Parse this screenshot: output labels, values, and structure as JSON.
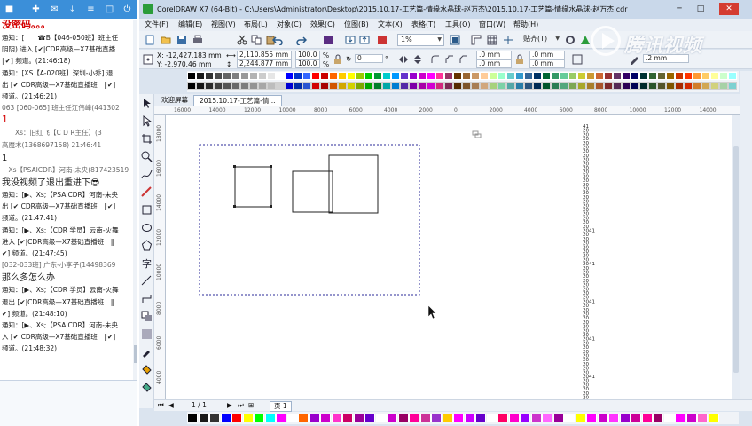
{
  "chat": {
    "title_icons": [
      "qq-icon",
      "game-icon",
      "mail-icon",
      "download-icon",
      "menu-icon",
      "restore-icon",
      "power-icon"
    ],
    "scroll_fraction": 0.95,
    "messages": [
      {
        "text": "没密码。。。",
        "style": "pass"
      },
      {
        "text": "通知：[　　☎B【046-050班】班主任",
        "style": ""
      },
      {
        "text": "阴阴) 进入 [✔|CDR高级—X7基础直播",
        "style": ""
      },
      {
        "text": "‖✔] 频道。(21:46:18)",
        "style": ""
      },
      {
        "text": "通知：[XS【A-020班】深圳-小乔] 退",
        "style": ""
      },
      {
        "text": "出 [✔|CDR高级—X7基础直播班　‖✔]",
        "style": ""
      },
      {
        "text": "频道。(21:46:21)",
        "style": ""
      },
      {
        "text": "063 [060-065] 班主任江伟峰(441302",
        "style": "gray"
      },
      {
        "text": "1",
        "style": "red"
      },
      {
        "text": "　　Xs：旧红飞【C D R主任】(3",
        "style": "gray"
      },
      {
        "text": "高魔术(1368697158) 21:46:41",
        "style": "gray"
      },
      {
        "text": "1",
        "style": "big"
      },
      {
        "text": "　Xs【PSAICDR】河南-未央(817423519",
        "style": "gray"
      },
      {
        "text": "我没视频了退出重进下😎",
        "style": "big"
      },
      {
        "text": "通知：[▶、Xs;【PSAICDR】河南-未央",
        "style": ""
      },
      {
        "text": "出 [✔|CDR高级—X7基础直播班　‖✔]",
        "style": ""
      },
      {
        "text": "频道。(21:47:41)",
        "style": ""
      },
      {
        "text": "通知：[▶、Xs;【CDR 学员】云南-火舞",
        "style": ""
      },
      {
        "text": "进入 [✔|CDR高级—X7基础直播班　‖",
        "style": ""
      },
      {
        "text": "✔] 频道。(21:47:45)",
        "style": ""
      },
      {
        "text": "[032-033班] 广东-小李子(14498369",
        "style": "gray"
      },
      {
        "text": "那么多怎么办",
        "style": "big"
      },
      {
        "text": "通知：[▶、Xs;【CDR 学员】云南-火舞",
        "style": ""
      },
      {
        "text": "退出 [✔|CDR高级—X7基础直播班　‖",
        "style": ""
      },
      {
        "text": "✔] 频道。(21:48:10)",
        "style": ""
      },
      {
        "text": "通知：[▶、Xs;【PSAICDR】河南-未央",
        "style": ""
      },
      {
        "text": "入 [✔|CDR高级—X7基础直播班　‖✔]",
        "style": ""
      },
      {
        "text": "频道。(21:48:32)",
        "style": ""
      }
    ]
  },
  "app": {
    "title": "CorelDRAW X7 (64-Bit) - C:\\Users\\Administrator\\Desktop\\2015.10.17-工艺篇-情缘水晶球-赵万杰\\2015.10.17-工艺篇-情缘水晶球-赵万杰.cdr",
    "window_buttons": {
      "minimize": "─",
      "maximize": "□",
      "close": "✕"
    },
    "menu": [
      "文件(F)",
      "编辑(E)",
      "视图(V)",
      "布局(L)",
      "对象(C)",
      "效果(C)",
      "位图(B)",
      "文本(X)",
      "表格(T)",
      "工具(O)",
      "窗口(W)",
      "帮助(H)"
    ],
    "toolbar": {
      "zoom": "1%",
      "snap": "贴齐(T)"
    },
    "props": {
      "x": "X: -12,427.183 mm",
      "y": "Y: -2,970.46 mm",
      "w": "2,110.855 mm",
      "h": "2,244.877 mm",
      "scale_w": "100.0",
      "scale_h": "100.0",
      "pct": "%",
      "angle": "0",
      "deg": "°",
      "corner_a": ".0 mm",
      "corner_b": ".0 mm",
      "corner_c": ".0 mm",
      "corner_d": ".0 mm",
      "outline": ".2 mm"
    },
    "tabs": {
      "welcome": "欢迎屏幕",
      "doc": "2015.10.17-工艺篇-情..."
    },
    "ruler_h": [
      "16000",
      "14000",
      "12000",
      "10000",
      "8000",
      "6000",
      "4000",
      "2000",
      "0",
      "2000",
      "4000",
      "6000",
      "8000",
      "10000",
      "12000",
      "14000"
    ],
    "ruler_v": [
      "18000",
      "16000",
      "14000",
      "12000",
      "10000",
      "8000",
      "6000",
      "4000"
    ],
    "number_column": [
      "41",
      "20",
      "20",
      "20",
      "20",
      "20",
      "20",
      "20",
      "20",
      "20",
      "20",
      "20",
      "20",
      "20",
      "20",
      "20",
      "20",
      "20",
      "20",
      "20",
      "20",
      "20",
      "20",
      "20",
      "20",
      "2041",
      "20",
      "20",
      "20",
      "20",
      "20",
      "20",
      "20",
      "2041",
      "20",
      "20",
      "20",
      "20",
      "20",
      "20",
      "20",
      "20",
      "2041",
      "20",
      "20",
      "20",
      "20",
      "20",
      "20",
      "20",
      "20",
      "2041",
      "20",
      "20",
      "20",
      "20",
      "20",
      "20",
      "20",
      "20",
      "2041",
      "20",
      "20",
      "20",
      "20",
      "20"
    ],
    "status": {
      "page_counter": "1 / 1",
      "page_tab": "页 1"
    },
    "watermark": "腾讯视频",
    "palette_colors": [
      "#000000",
      "#1a1a1a",
      "#333333",
      "#4d4d4d",
      "#666666",
      "#808080",
      "#999999",
      "#b3b3b3",
      "#cccccc",
      "#e6e6e6",
      "#ffffff",
      "#0000ff",
      "#0033cc",
      "#3366ff",
      "#ff0000",
      "#cc0000",
      "#ff6600",
      "#ffcc00",
      "#ffff00",
      "#99cc00",
      "#00cc00",
      "#009933",
      "#00cccc",
      "#0099ff",
      "#6633cc",
      "#9900cc",
      "#cc00cc",
      "#ff00ff",
      "#ff3399",
      "#993366",
      "#663300",
      "#996633",
      "#cc9966",
      "#ffcc99",
      "#ccff99",
      "#99ffcc",
      "#66cccc",
      "#3399cc",
      "#336699",
      "#003366",
      "#006633",
      "#339966",
      "#66cc99",
      "#99cc66",
      "#cccc33",
      "#cc9933",
      "#cc6633",
      "#993333",
      "#663366",
      "#330066",
      "#000066",
      "#003333",
      "#336633",
      "#666633",
      "#996600",
      "#cc3300",
      "#ff3300",
      "#ff9933",
      "#ffcc66",
      "#ffff99",
      "#ccffcc",
      "#99ffff"
    ],
    "bottom_colors": [
      "#000000",
      "#1a1a1a",
      "#333333",
      "#0000ff",
      "#ff0000",
      "#ffff00",
      "#00ff00",
      "#00ffff",
      "#ff00ff",
      "#ffffff",
      "#ff6600",
      "#9900cc",
      "#cc00cc",
      "#ff33cc",
      "#cc0066",
      "#990099",
      "#6600cc",
      "#ffffff",
      "#cc00cc",
      "#990066",
      "#ff0099",
      "#cc3399",
      "#9933cc",
      "#ffcc00",
      "#ff00ff",
      "#cc00ff",
      "#6600cc",
      "#ffffff",
      "#ff0066",
      "#ff00cc",
      "#9900ff",
      "#cc33cc",
      "#ff66ff",
      "#990099",
      "#ffffff",
      "#ffff00",
      "#ff00ff",
      "#cc00cc",
      "#ff33ff",
      "#9900cc",
      "#cc0099",
      "#ff0099",
      "#990066",
      "#ffffff",
      "#ff00ff",
      "#cc00cc",
      "#ff66cc",
      "#ffff00"
    ]
  }
}
